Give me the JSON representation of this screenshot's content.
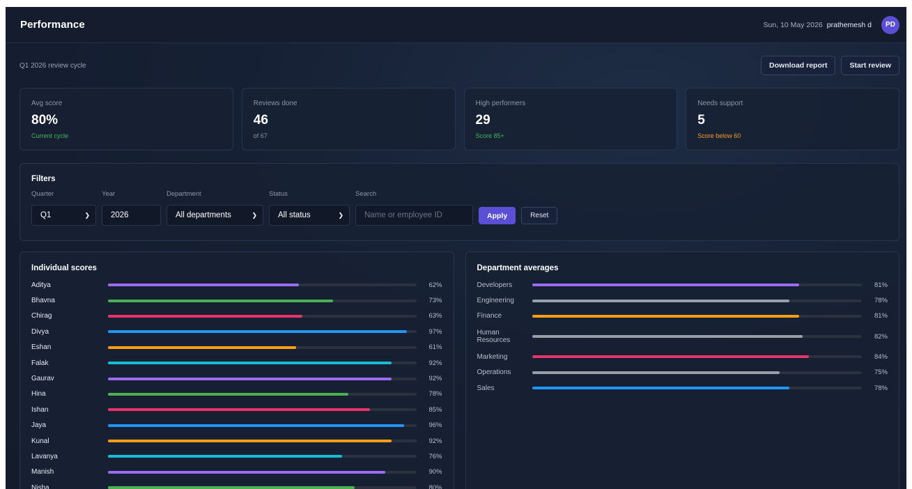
{
  "header": {
    "title": "Performance",
    "date": "Sun, 10 May 2026",
    "user": "prathemesh d",
    "avatar_initials": "PD"
  },
  "subheader": {
    "cycle": "Q1 2026 review cycle",
    "download_label": "Download report",
    "start_label": "Start review"
  },
  "stats": [
    {
      "label": "Avg score",
      "value": "80%",
      "note": "Current cycle",
      "note_color": "#3fb75b"
    },
    {
      "label": "Reviews done",
      "value": "46",
      "note": "of 67",
      "note_color": "#8e97aa"
    },
    {
      "label": "High performers",
      "value": "29",
      "note": "Score 85+",
      "note_color": "#3fb75b"
    },
    {
      "label": "Needs support",
      "value": "5",
      "note": "Score below 60",
      "note_color": "#ff9a1f"
    }
  ],
  "filters": {
    "title": "Filters",
    "quarter_label": "Quarter",
    "quarter_value": "Q1",
    "year_label": "Year",
    "year_value": "2026",
    "department_label": "Department",
    "department_value": "All departments",
    "status_label": "Status",
    "status_value": "All status",
    "search_label": "Search",
    "search_placeholder": "Name or employee ID",
    "apply_label": "Apply",
    "reset_label": "Reset"
  },
  "individual": {
    "title": "Individual scores",
    "rows": [
      {
        "name": "Aditya",
        "score": 62,
        "pct": "62%",
        "color": "#9b6cf2"
      },
      {
        "name": "Bhavna",
        "score": 73,
        "pct": "73%",
        "color": "#4caf50"
      },
      {
        "name": "Chirag",
        "score": 63,
        "pct": "63%",
        "color": "#e8336a"
      },
      {
        "name": "Divya",
        "score": 97,
        "pct": "97%",
        "color": "#2196f3"
      },
      {
        "name": "Eshan",
        "score": 61,
        "pct": "61%",
        "color": "#ff9d14"
      },
      {
        "name": "Falak",
        "score": 92,
        "pct": "92%",
        "color": "#19bcd2"
      },
      {
        "name": "Gaurav",
        "score": 92,
        "pct": "92%",
        "color": "#9b6cf2"
      },
      {
        "name": "Hina",
        "score": 78,
        "pct": "78%",
        "color": "#4caf50"
      },
      {
        "name": "Ishan",
        "score": 85,
        "pct": "85%",
        "color": "#e8336a"
      },
      {
        "name": "Jaya",
        "score": 96,
        "pct": "96%",
        "color": "#2196f3"
      },
      {
        "name": "Kunal",
        "score": 92,
        "pct": "92%",
        "color": "#ff9d14"
      },
      {
        "name": "Lavanya",
        "score": 76,
        "pct": "76%",
        "color": "#19bcd2"
      },
      {
        "name": "Manish",
        "score": 90,
        "pct": "90%",
        "color": "#9b6cf2"
      },
      {
        "name": "Nisha",
        "score": 80,
        "pct": "80%",
        "color": "#4caf50"
      }
    ]
  },
  "departments": {
    "title": "Department averages",
    "rows": [
      {
        "name": "Developers",
        "score": 81,
        "pct": "81%",
        "color": "#9b6cf2"
      },
      {
        "name": "Engineering",
        "score": 78,
        "pct": "78%",
        "color": "#9a9ea6"
      },
      {
        "name": "Finance",
        "score": 81,
        "pct": "81%",
        "color": "#ff9d14"
      },
      {
        "name": "Human Resources",
        "score": 82,
        "pct": "82%",
        "color": "#9a9ea6"
      },
      {
        "name": "Marketing",
        "score": 84,
        "pct": "84%",
        "color": "#e8336a"
      },
      {
        "name": "Operations",
        "score": 75,
        "pct": "75%",
        "color": "#9a9ea6"
      },
      {
        "name": "Sales",
        "score": 78,
        "pct": "78%",
        "color": "#2196f3"
      }
    ]
  }
}
